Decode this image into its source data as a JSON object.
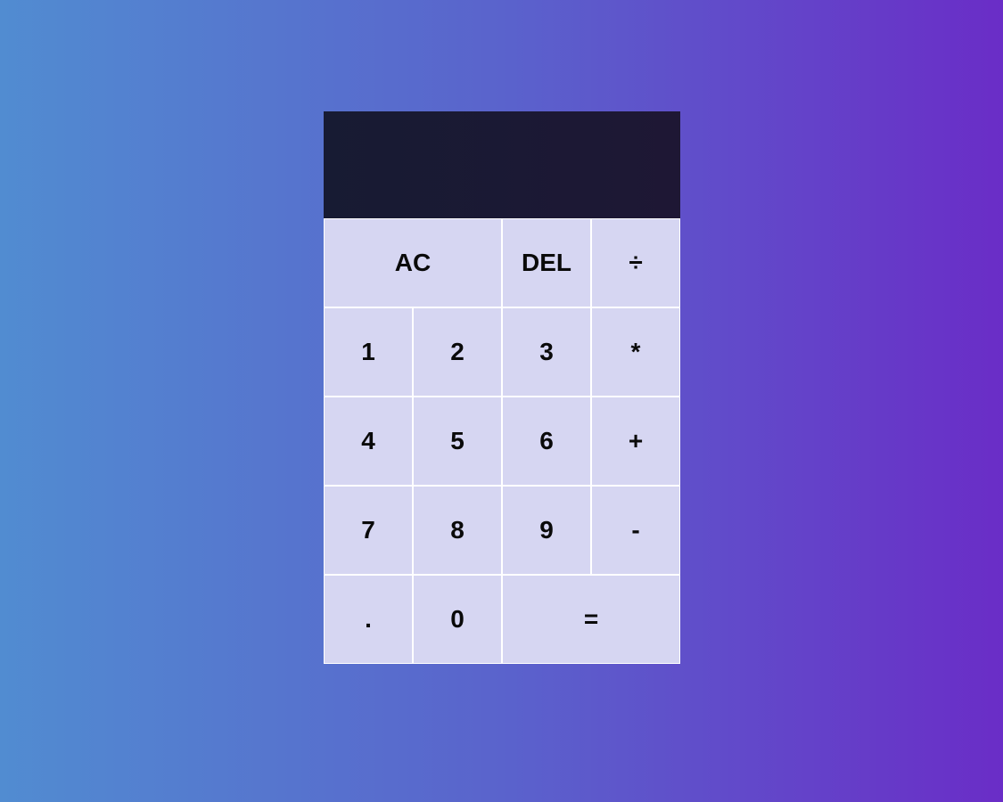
{
  "display": {
    "previous_operand": "",
    "current_operand": ""
  },
  "keys": {
    "clear": "AC",
    "delete": "DEL",
    "divide": "÷",
    "one": "1",
    "two": "2",
    "three": "3",
    "multiply": "*",
    "four": "4",
    "five": "5",
    "six": "6",
    "add": "+",
    "seven": "7",
    "eight": "8",
    "nine": "9",
    "subtract": "-",
    "decimal": ".",
    "zero": "0",
    "equals": "="
  },
  "colors": {
    "background_start": "#518cd1",
    "background_end": "#6a2dc7",
    "display_bg": "#1b1a33",
    "key_bg": "#d6d6f2",
    "key_border": "#ffffff",
    "key_text": "#0a0a0a"
  }
}
